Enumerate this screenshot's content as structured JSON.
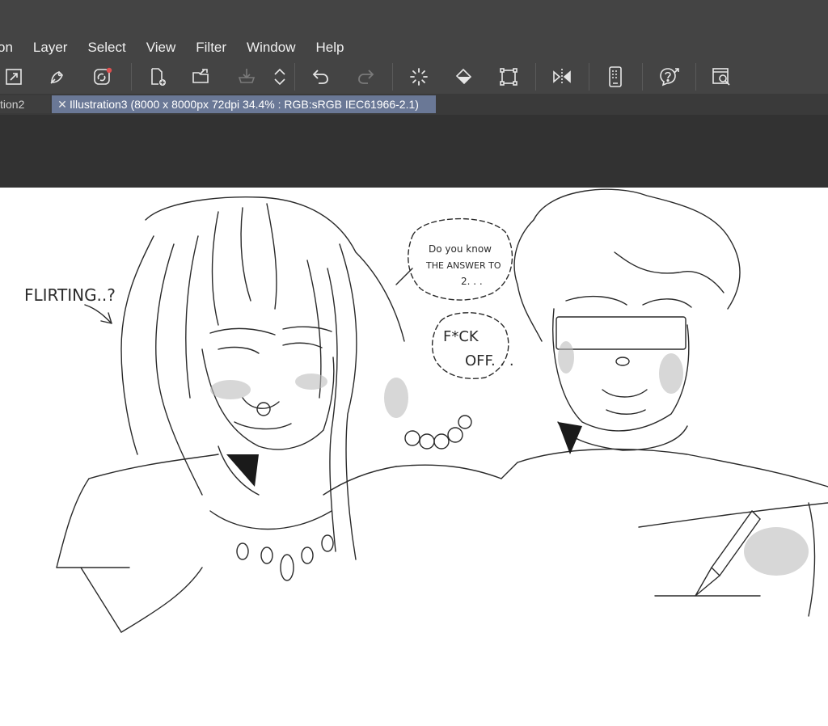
{
  "menu": {
    "items": [
      {
        "label": "on"
      },
      {
        "label": "Layer"
      },
      {
        "label": "Select"
      },
      {
        "label": "View"
      },
      {
        "label": "Filter"
      },
      {
        "label": "Window"
      },
      {
        "label": "Help"
      }
    ]
  },
  "toolbar": {
    "buttons": [
      {
        "icon": "expand-icon"
      },
      {
        "icon": "edit-link-icon"
      },
      {
        "icon": "cloud-sync-icon"
      },
      {
        "icon": "new-file-icon"
      },
      {
        "icon": "open-folder-icon"
      },
      {
        "icon": "save-icon"
      },
      {
        "icon": "up-down-icon"
      },
      {
        "icon": "undo-icon"
      },
      {
        "icon": "redo-icon"
      },
      {
        "icon": "loading-icon"
      },
      {
        "icon": "fill-icon"
      },
      {
        "icon": "transform-icon"
      },
      {
        "icon": "flip-horizontal-icon"
      },
      {
        "icon": "device-icon"
      },
      {
        "icon": "help-icon"
      },
      {
        "icon": "search-window-icon"
      }
    ]
  },
  "tabs": {
    "inactive_label": "tion2",
    "active_label": "Illustration3 (8000 x 8000px 72dpi 34.4% : RGB:sRGB IEC61966-2.1)"
  },
  "artwork": {
    "flirting": "FLIRTING..?",
    "bubble1_line1": "Do you know",
    "bubble1_line2": "THE ANSWER TO",
    "bubble1_line3": "2. . .",
    "bubble2_line1": "F*CK",
    "bubble2_line2": "OFF. . ."
  },
  "colors": {
    "chrome": "#444444",
    "tab_active": "#6a7896",
    "canvas_bg": "#323232"
  }
}
